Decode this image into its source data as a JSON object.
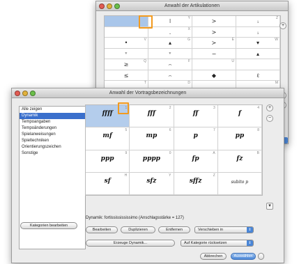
{
  "window_artikulationen": {
    "title": "Anwahl der Artikulationen",
    "side_controls": [
      "+",
      "−",
      "+"
    ],
    "rows": [
      [
        {
          "sym": "",
          "num": ""
        },
        {
          "sym": "ǀ",
          "num": "Y"
        },
        {
          "sym": ">",
          "num": ""
        },
        {
          "sym": "ᵢ",
          "num": "Z"
        }
      ],
      [
        {
          "sym": "",
          "num": ""
        },
        {
          "sym": ".",
          "num": "X"
        },
        {
          "sym": ">",
          "num": ""
        },
        {
          "sym": "ᵢ",
          "num": ""
        }
      ],
      [
        {
          "sym": "•",
          "num": "V"
        },
        {
          "sym": "▴",
          "num": "G"
        },
        {
          "sym": "≻",
          "num": "E"
        },
        {
          "sym": "▾",
          "num": "W"
        }
      ],
      [
        {
          "sym": "ᵛ",
          "num": ""
        },
        {
          "sym": "ᵛ",
          "num": ""
        },
        {
          "sym": "−",
          "num": ""
        },
        {
          "sym": "▴",
          "num": ""
        }
      ],
      [
        {
          "sym": "≥",
          "num": "Q"
        },
        {
          "sym": "⌢",
          "num": "F"
        },
        {
          "sym": "",
          "num": "U"
        },
        {
          "sym": "",
          "num": ""
        }
      ],
      [
        {
          "sym": "≤",
          "num": ""
        },
        {
          "sym": "⌢",
          "num": ""
        },
        {
          "sym": "◆",
          "num": ""
        },
        {
          "sym": "ℓ",
          "num": ""
        }
      ],
      [
        {
          "sym": "",
          "num": "T"
        },
        {
          "sym": "",
          "num": "D"
        },
        {
          "sym": "",
          "num": ""
        },
        {
          "sym": "",
          "num": "M"
        }
      ],
      [
        {
          "sym": "",
          "num": ""
        },
        {
          "sym": "",
          "num": ""
        },
        {
          "sym": "",
          "num": ""
        },
        {
          "sym": "",
          "num": ""
        }
      ]
    ]
  },
  "window_vortrag": {
    "title": "Anwahl der Vortragsbezeichnungen",
    "categories": [
      {
        "label": "Alle zeigen",
        "selected": false
      },
      {
        "label": "Dynamik",
        "selected": true
      },
      {
        "label": "Tempoangaben",
        "selected": false
      },
      {
        "label": "Tempoänderungen",
        "selected": false
      },
      {
        "label": "Spielanweisungen",
        "selected": false
      },
      {
        "label": "Spieltechniken",
        "selected": false
      },
      {
        "label": "Orientierungszeichen",
        "selected": false
      },
      {
        "label": "Sonstige",
        "selected": false
      }
    ],
    "grid": [
      [
        {
          "sym": "ffff",
          "num": "1"
        },
        {
          "sym": "fff",
          "num": "2"
        },
        {
          "sym": "ff",
          "num": "3"
        },
        {
          "sym": "f",
          "num": "4"
        }
      ],
      [
        {
          "sym": "mf",
          "num": "5"
        },
        {
          "sym": "mp",
          "num": "6"
        },
        {
          "sym": "p",
          "num": "7"
        },
        {
          "sym": "pp",
          "num": "8"
        }
      ],
      [
        {
          "sym": "ppp",
          "num": "9"
        },
        {
          "sym": "pppp",
          "num": "0"
        },
        {
          "sym": "fp",
          "num": "A"
        },
        {
          "sym": "fz",
          "num": "B"
        }
      ],
      [
        {
          "sym": "sf",
          "num": "H"
        },
        {
          "sym": "sfz",
          "num": "Y"
        },
        {
          "sym": "sffz",
          "num": "Z"
        },
        {
          "sym": "subito p",
          "num": ""
        }
      ]
    ],
    "status_text": "Dynamik: fortississississimo (Anschlagsstärke = 127)",
    "buttons": {
      "edit_categories": "Kategorien bearbeiten",
      "edit": "Bearbeiten",
      "duplicate": "Duplizieren",
      "remove": "Entfernen",
      "create": "Erzeuge Dynamik...",
      "cancel": "Abbrechen",
      "select": "Auswählen"
    },
    "popups": {
      "move_to": "Verschieben in",
      "reset": "Auf Kategorie rücksetzen"
    },
    "scroll_controls": [
      "+",
      "−",
      "▾"
    ]
  },
  "colors": {
    "highlight": "#f29a1e",
    "selection": "#b4cdec",
    "accent": "#4a86d7"
  }
}
